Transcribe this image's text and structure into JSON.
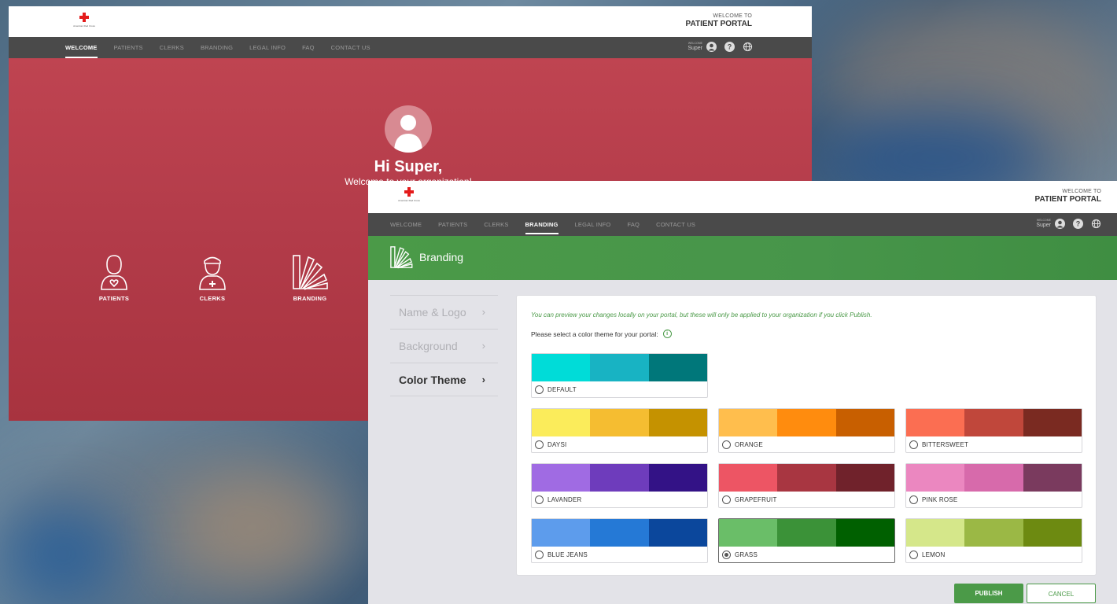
{
  "brand": {
    "org_name": "American Red Cross"
  },
  "portal_header": {
    "welcome_small": "WELCOME TO",
    "portal_name": "PATIENT PORTAL"
  },
  "user": {
    "welcome_small": "WELCOME",
    "name": "Super"
  },
  "back_window": {
    "nav": [
      "WELCOME",
      "PATIENTS",
      "CLERKS",
      "BRANDING",
      "LEGAL INFO",
      "FAQ",
      "CONTACT US"
    ],
    "active_nav": "WELCOME",
    "greeting": "Hi Super,",
    "greeting_sub": "Welcome to your organization!",
    "tiles": [
      "PATIENTS",
      "CLERKS",
      "BRANDING"
    ]
  },
  "front_window": {
    "nav": [
      "WELCOME",
      "PATIENTS",
      "CLERKS",
      "BRANDING",
      "LEGAL INFO",
      "FAQ",
      "CONTACT US"
    ],
    "active_nav": "BRANDING",
    "page_title": "Branding",
    "sidebar": [
      {
        "label": "Name & Logo",
        "active": false
      },
      {
        "label": "Background",
        "active": false
      },
      {
        "label": "Color Theme",
        "active": true
      }
    ],
    "note": "You can preview your changes locally on your portal, but these will only be applied to your organization if you click Publish.",
    "prompt": "Please select a color theme for your portal:",
    "themes": [
      {
        "name": "DEFAULT",
        "colors": [
          "#00dcd8",
          "#18b3c3",
          "#00777a"
        ],
        "selected": false
      },
      {
        "name": "DAYSI",
        "colors": [
          "#fbec5b",
          "#f5bd31",
          "#c59200"
        ],
        "selected": false
      },
      {
        "name": "ORANGE",
        "colors": [
          "#ffbe4d",
          "#ff8c0e",
          "#c85f00"
        ],
        "selected": false
      },
      {
        "name": "BITTERSWEET",
        "colors": [
          "#fb6e52",
          "#c0473b",
          "#7a2a21"
        ],
        "selected": false
      },
      {
        "name": "LAVANDER",
        "colors": [
          "#a06be3",
          "#6e3cbc",
          "#331286"
        ],
        "selected": false
      },
      {
        "name": "GRAPEFRUIT",
        "colors": [
          "#ed5564",
          "#a83641",
          "#70222b"
        ],
        "selected": false
      },
      {
        "name": "PINK ROSE",
        "colors": [
          "#eb87c0",
          "#d76aab",
          "#7a3a5e"
        ],
        "selected": false
      },
      {
        "name": "BLUE JEANS",
        "colors": [
          "#5d9cec",
          "#2579d6",
          "#0b479c"
        ],
        "selected": false
      },
      {
        "name": "GRASS",
        "colors": [
          "#6abe68",
          "#3b9238",
          "#006000"
        ],
        "selected": true
      },
      {
        "name": "LEMON",
        "colors": [
          "#d5e78a",
          "#9bb845",
          "#6d8a11"
        ],
        "selected": false
      }
    ],
    "publish_label": "PUBLISH",
    "cancel_label": "CANCEL"
  }
}
